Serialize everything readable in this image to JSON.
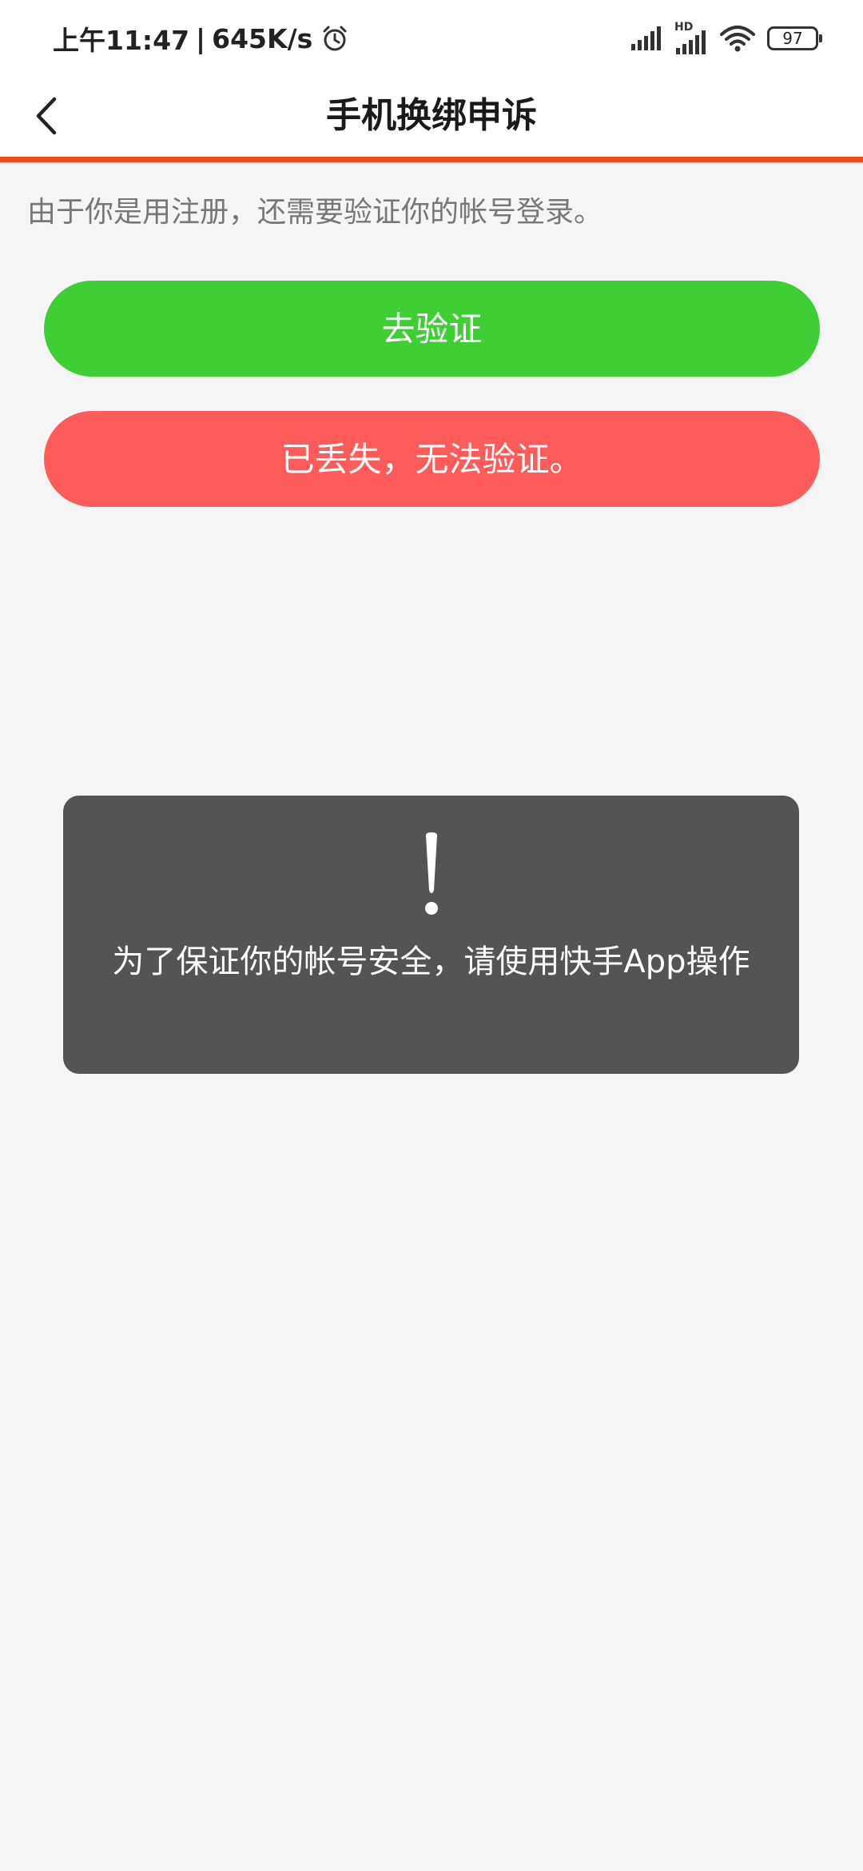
{
  "status_bar": {
    "time": "上午11:47",
    "separator": "|",
    "net_speed": "645K/s",
    "battery_level": "97",
    "hd_label": "HD"
  },
  "nav": {
    "title": "手机换绑申诉"
  },
  "content": {
    "hint": "由于你是用注册，还需要验证你的帐号登录。",
    "verify_button": "去验证",
    "lost_button": "已丢失，无法验证。"
  },
  "toast": {
    "message": "为了保证你的帐号安全，请使用快手App操作"
  },
  "colors": {
    "accent": "#f04a15",
    "verify": "#3dcf33",
    "lost": "#fe5b5b",
    "toast_bg": "#545454"
  }
}
